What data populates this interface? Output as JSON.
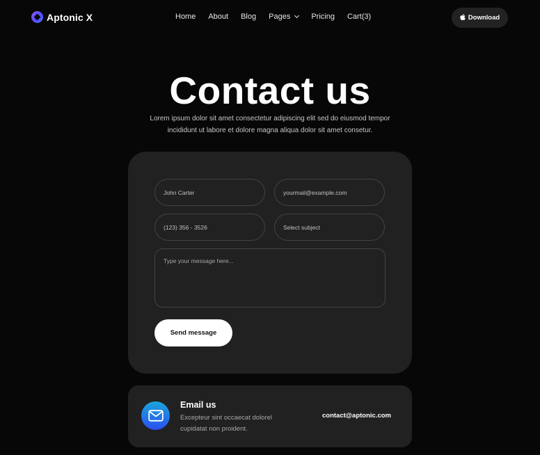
{
  "brand": {
    "name": "Aptonic X",
    "logo_icon": "diamond-logo-icon"
  },
  "nav": {
    "items": [
      {
        "label": "Home"
      },
      {
        "label": "About"
      },
      {
        "label": "Blog"
      },
      {
        "label": "Pages",
        "has_dropdown": true
      },
      {
        "label": "Pricing"
      },
      {
        "label": "Cart(3)"
      }
    ],
    "download_label": "Download",
    "download_icon": "apple-icon"
  },
  "hero": {
    "title": "Contact us",
    "subtitle_line1": "Lorem ipsum dolor sit amet consectetur adipiscing elit sed do eiusmod tempor",
    "subtitle_line2": "incididunt ut labore et dolore magna aliqua dolor sit amet consetur."
  },
  "form": {
    "name_placeholder": "John Carter",
    "email_placeholder": "yourmail@example.com",
    "phone_placeholder": "(123) 356 - 3526",
    "subject_placeholder": "Select subject",
    "message_placeholder": "Type your message here...",
    "submit_label": "Send message"
  },
  "email_card": {
    "icon": "envelope-icon",
    "title": "Email us",
    "description": "Excepteur sint occaecat dolorel cupidatat non proident.",
    "address": "contact@aptonic.com"
  },
  "colors": {
    "background": "#070707",
    "card": "#212121",
    "accent_gradient_start": "#1aa6dc",
    "accent_gradient_end": "#2a4ff0",
    "logo_purple": "#8a5cff"
  }
}
